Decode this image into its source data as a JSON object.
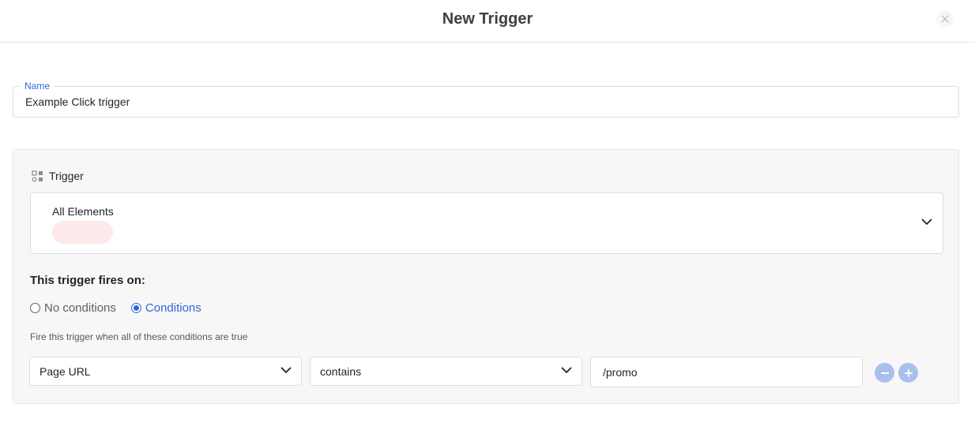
{
  "dialog": {
    "title": "New Trigger",
    "close_icon": "close-icon"
  },
  "name_field": {
    "label": "Name",
    "value": "Example Click trigger"
  },
  "trigger_section": {
    "title": "Trigger",
    "icon": "trigger-type-icon",
    "selected": "All Elements"
  },
  "fires_on": {
    "heading": "This trigger fires on:",
    "options": [
      {
        "label": "No conditions",
        "selected": false
      },
      {
        "label": "Conditions",
        "selected": true
      }
    ],
    "hint": "Fire this trigger when all of these conditions are true"
  },
  "condition": {
    "variable": "Page URL",
    "operator": "contains",
    "value": "/promo"
  },
  "colors": {
    "accent": "#2e6ad6",
    "round_button": "#a9bfee",
    "pill": "#fde9e9",
    "panel_bg": "#f7f7f8"
  }
}
